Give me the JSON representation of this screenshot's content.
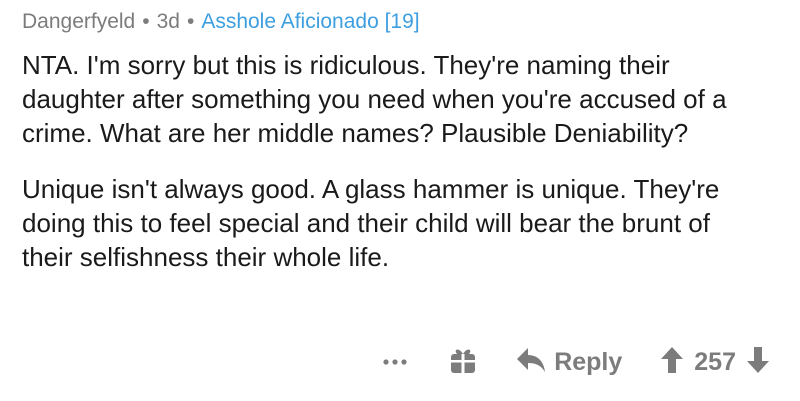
{
  "comment": {
    "author": "Dangerfyeld",
    "separator": "•",
    "age": "3d",
    "flair": "Asshole Aficionado [19]",
    "paragraphs": [
      "NTA. I'm sorry but this is ridiculous. They're naming their daughter after something you need when you're accused of a crime. What are her middle names? Plausible Deniability?",
      "Unique isn't always good. A glass hammer is unique. They're doing this to feel special and their child will bear the brunt of their selfishness their whole life."
    ]
  },
  "actions": {
    "more_icon": "ellipsis-icon",
    "award_icon": "gift-icon",
    "reply_icon": "reply-arrow-icon",
    "reply_label": "Reply",
    "upvote_icon": "up-arrow-icon",
    "score": "257",
    "downvote_icon": "down-arrow-icon"
  },
  "colors": {
    "flair": "#3d9ee0",
    "meta_text": "#7c7c7c",
    "body_text": "#1a1a1b"
  }
}
